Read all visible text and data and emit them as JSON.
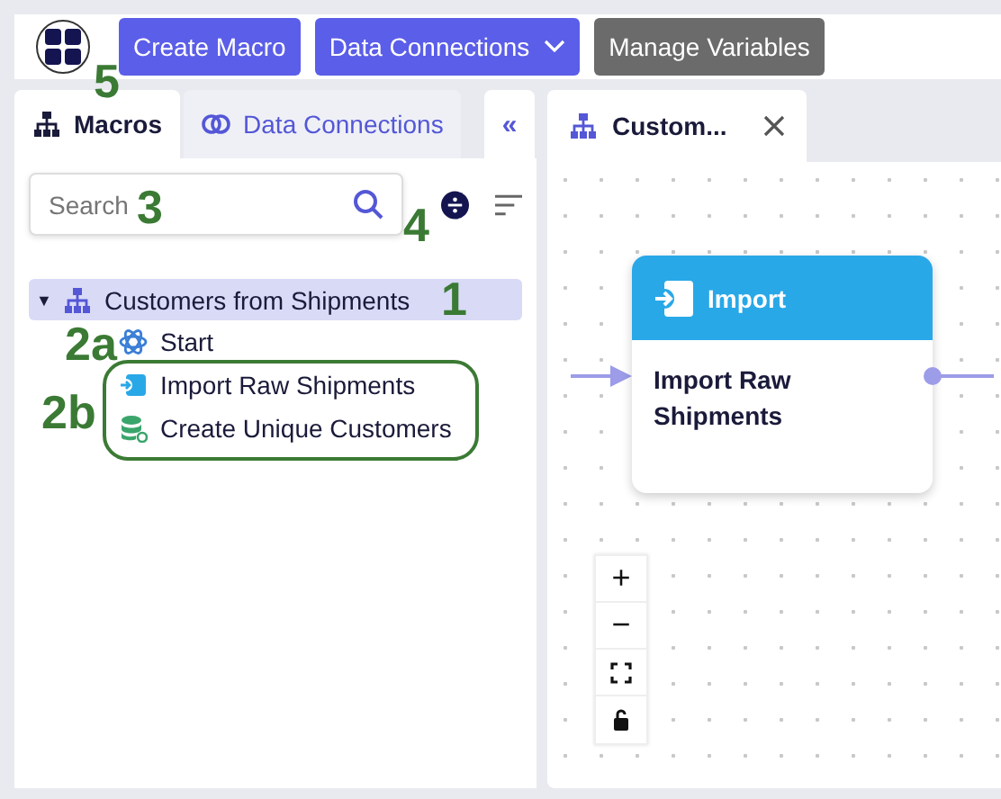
{
  "toolbar": {
    "buttons": [
      {
        "label": "Create Macro",
        "kind": "primary",
        "dropdown": false
      },
      {
        "label": "Data Connections",
        "kind": "primary",
        "dropdown": true
      },
      {
        "label": "Manage Variables",
        "kind": "secondary",
        "dropdown": false
      }
    ]
  },
  "sidebar": {
    "tabs": [
      {
        "label": "Macros",
        "selected": true
      },
      {
        "label": "Data Connections",
        "selected": false
      }
    ],
    "collapse": "«",
    "search": {
      "placeholder": "Search"
    },
    "tree": [
      {
        "label": "Customers from Shipments",
        "caret": "▼",
        "kind": "macro",
        "selected": true,
        "expanded": true,
        "children": [
          {
            "label": "Start",
            "kind": "start",
            "selected": false
          },
          {
            "label": "Import Raw Shipments",
            "kind": "import",
            "selected": false
          },
          {
            "label": "Create Unique Customers",
            "kind": "transform",
            "selected": false
          }
        ]
      }
    ]
  },
  "editor": {
    "tabs": [
      {
        "label": "Custom...",
        "selected": true
      }
    ],
    "node": {
      "header": "Import",
      "body": "Import Raw Shipments"
    },
    "zoom_controls": [
      "+",
      "−"
    ]
  },
  "annotations": [
    {
      "label": "5",
      "kind": "number"
    },
    {
      "label": "3",
      "kind": "number"
    },
    {
      "label": "4",
      "kind": "number"
    },
    {
      "label": "1",
      "kind": "number"
    },
    {
      "label": "2a",
      "kind": "number"
    },
    {
      "label": "2b",
      "kind": "number"
    },
    {
      "kind": "outline"
    }
  ]
}
